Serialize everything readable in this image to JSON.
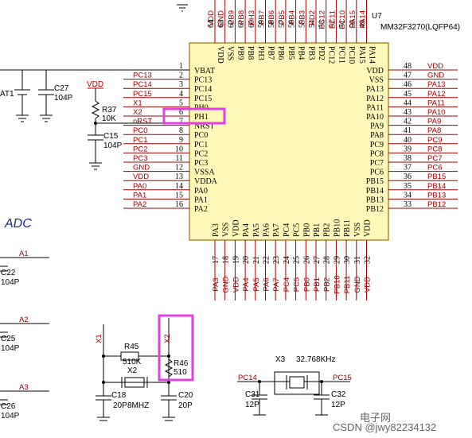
{
  "chip": {
    "designator": "U7",
    "part": "MM32F3270(LQFP64)",
    "left_pins": [
      {
        "num": "1",
        "name": "VBAT",
        "net": ""
      },
      {
        "num": "2",
        "name": "PC13",
        "net": "PC13"
      },
      {
        "num": "3",
        "name": "PC14",
        "net": "PC14"
      },
      {
        "num": "4",
        "name": "PC15",
        "net": "PC15"
      },
      {
        "num": "5",
        "name": "PH0",
        "net": "X1"
      },
      {
        "num": "6",
        "name": "PH1",
        "net": "X2"
      },
      {
        "num": "7",
        "name": "NRST",
        "net": "nRST"
      },
      {
        "num": "8",
        "name": "PC0",
        "net": "PC0"
      },
      {
        "num": "9",
        "name": "PC1",
        "net": "PC1"
      },
      {
        "num": "10",
        "name": "PC2",
        "net": "PC2"
      },
      {
        "num": "11",
        "name": "PC3",
        "net": "PC3"
      },
      {
        "num": "12",
        "name": "VSSA",
        "net": "GND"
      },
      {
        "num": "13",
        "name": "VDDA",
        "net": "VDD"
      },
      {
        "num": "14",
        "name": "PA0",
        "net": "PA0"
      },
      {
        "num": "15",
        "name": "PA1",
        "net": "PA1"
      },
      {
        "num": "16",
        "name": "PA2",
        "net": "PA2"
      }
    ],
    "right_pins": [
      {
        "num": "48",
        "name": "VDD",
        "net": "VDD"
      },
      {
        "num": "47",
        "name": "VSS",
        "net": "GND"
      },
      {
        "num": "46",
        "name": "PA13",
        "net": "PA13"
      },
      {
        "num": "45",
        "name": "PA12",
        "net": "PA12"
      },
      {
        "num": "44",
        "name": "PA11",
        "net": "PA11"
      },
      {
        "num": "43",
        "name": "PA10",
        "net": "PA10"
      },
      {
        "num": "42",
        "name": "PA9",
        "net": "PA9"
      },
      {
        "num": "41",
        "name": "PA8",
        "net": "PA8"
      },
      {
        "num": "40",
        "name": "PC9",
        "net": "PC9"
      },
      {
        "num": "39",
        "name": "PC8",
        "net": "PC8"
      },
      {
        "num": "38",
        "name": "PC7",
        "net": "PC7"
      },
      {
        "num": "37",
        "name": "PC6",
        "net": "PC6"
      },
      {
        "num": "36",
        "name": "PB15",
        "net": "PB15"
      },
      {
        "num": "35",
        "name": "PB14",
        "net": "PB14"
      },
      {
        "num": "34",
        "name": "PB13",
        "net": "PB13"
      },
      {
        "num": "33",
        "name": "PB12",
        "net": "PB12"
      }
    ],
    "top_pins": [
      {
        "num": "64",
        "name": "VDD",
        "net": "VDD"
      },
      {
        "num": "63",
        "name": "VSS",
        "net": "GND"
      },
      {
        "num": "62",
        "name": "PB9",
        "net": "PB9"
      },
      {
        "num": "61",
        "name": "PB8",
        "net": "PB8"
      },
      {
        "num": "60",
        "name": "PH3",
        "net": "PH3"
      },
      {
        "num": "59",
        "name": "PB7",
        "net": "PB7"
      },
      {
        "num": "58",
        "name": "PB6",
        "net": "PB6"
      },
      {
        "num": "57",
        "name": "PB5",
        "net": "PB5"
      },
      {
        "num": "56",
        "name": "PB4",
        "net": "PB4"
      },
      {
        "num": "55",
        "name": "PB3",
        "net": "PB3"
      },
      {
        "num": "54",
        "name": "PD2",
        "net": "PD2"
      },
      {
        "num": "53",
        "name": "PC12",
        "net": "PC12"
      },
      {
        "num": "52",
        "name": "PC11",
        "net": "PC11"
      },
      {
        "num": "51",
        "name": "PC10",
        "net": "PC10"
      },
      {
        "num": "50",
        "name": "PA15",
        "net": "PA15"
      },
      {
        "num": "49",
        "name": "PA14",
        "net": "PA14"
      }
    ],
    "bottom_pins": [
      {
        "num": "17",
        "name": "PA3",
        "net": "PA3"
      },
      {
        "num": "18",
        "name": "VSS",
        "net": "GND"
      },
      {
        "num": "19",
        "name": "VDD",
        "net": "VDD"
      },
      {
        "num": "20",
        "name": "PA4",
        "net": "PA4"
      },
      {
        "num": "21",
        "name": "PA5",
        "net": "PA5"
      },
      {
        "num": "22",
        "name": "PA6",
        "net": "PA6"
      },
      {
        "num": "23",
        "name": "PA7",
        "net": "PA7"
      },
      {
        "num": "24",
        "name": "PC4",
        "net": "PC4"
      },
      {
        "num": "25",
        "name": "PC5",
        "net": "PC5"
      },
      {
        "num": "26",
        "name": "PB0",
        "net": "PB0"
      },
      {
        "num": "27",
        "name": "PB1",
        "net": "PB1"
      },
      {
        "num": "28",
        "name": "PB2",
        "net": "PB2"
      },
      {
        "num": "29",
        "name": "PB10",
        "net": "PB10"
      },
      {
        "num": "30",
        "name": "PB11",
        "net": "PB11"
      },
      {
        "num": "31",
        "name": "VSS",
        "net": "GND"
      },
      {
        "num": "32",
        "name": "VDD",
        "net": "VDD"
      }
    ]
  },
  "components": {
    "r37": {
      "ref": "R37",
      "value": "10K",
      "supply": "VDD"
    },
    "c15": {
      "ref": "C15",
      "value": "104P"
    },
    "c27": {
      "ref": "C27",
      "value": "104P"
    },
    "bat": {
      "ref": "AT1"
    },
    "r45": {
      "ref": "R45",
      "value": "510K"
    },
    "r46": {
      "ref": "R46",
      "value": "510"
    },
    "x2": {
      "ref": "X2",
      "value": "8MHZ"
    },
    "c18": {
      "ref": "C18",
      "value": "20P"
    },
    "c20": {
      "ref": "C20",
      "value": "20P"
    },
    "x3": {
      "ref": "X3",
      "value": "32.768KHz"
    },
    "c31": {
      "ref": "C31",
      "value": "12P"
    },
    "c32": {
      "ref": "C32",
      "value": "12P"
    },
    "net_x1": "X1",
    "net_x2": "X2",
    "net_pc14": "PC14",
    "net_pc15": "PC15"
  },
  "adc": {
    "title": "ADC",
    "nets": [
      "A1",
      "A2",
      "A3"
    ],
    "caps": [
      {
        "ref": "C22",
        "value": "104P"
      },
      {
        "ref": "C25",
        "value": "104P"
      },
      {
        "ref": "C26",
        "value": "104P"
      }
    ]
  },
  "watermark": {
    "csdn": "CSDN @jwy82234132",
    "site": "电子网"
  },
  "colors": {
    "chip_fill": "#fff8b8",
    "chip_stroke": "#a07000",
    "net_text": "#a00000",
    "highlight": "#e040e0"
  }
}
